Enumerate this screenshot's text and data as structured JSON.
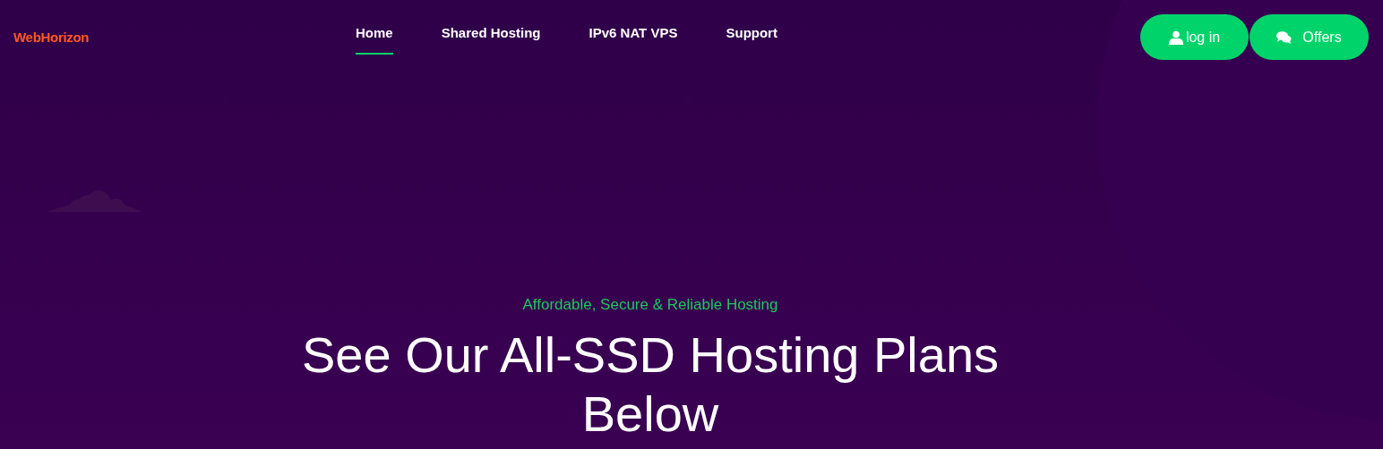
{
  "brand": "WebHorizon",
  "nav": [
    {
      "label": "Home",
      "selected": true
    },
    {
      "label": "Shared Hosting",
      "selected": false
    },
    {
      "label": "IPv6 NAT VPS",
      "selected": false
    },
    {
      "label": "Support",
      "selected": false
    }
  ],
  "buttons": [
    {
      "label": "log in",
      "kind": "user"
    },
    {
      "label": "Offers",
      "kind": "chat"
    }
  ],
  "hero": {
    "subtitle": "Affordable, Secure & Reliable Hosting",
    "title": "See Our All-SSD Hosting Plans Below"
  }
}
